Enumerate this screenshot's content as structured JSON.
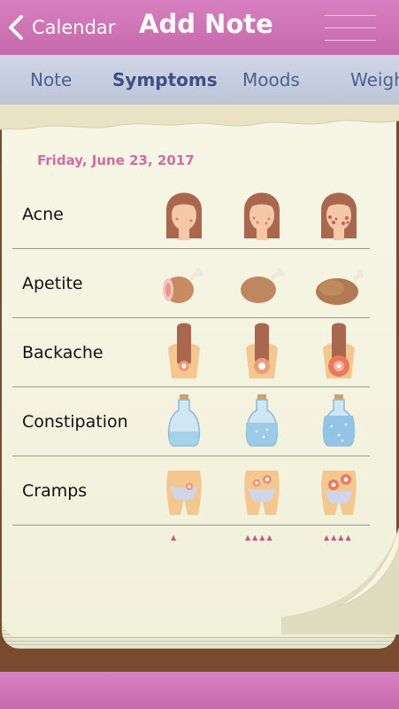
{
  "header": {
    "back_label": "Calendar",
    "title": "Add Note"
  },
  "tabs": [
    {
      "label": "Note"
    },
    {
      "label": "Symptoms"
    },
    {
      "label": "Moods"
    },
    {
      "label": "Weigh"
    }
  ],
  "content": {
    "date": "Friday, June 23, 2017",
    "rows": [
      {
        "label": "Acne",
        "icon": "face-icon"
      },
      {
        "label": "Apetite",
        "icon": "drumstick-icon"
      },
      {
        "label": "Backache",
        "icon": "back-icon"
      },
      {
        "label": "Constipation",
        "icon": "bottle-icon"
      },
      {
        "label": "Cramps",
        "icon": "hips-icon"
      }
    ],
    "severity_markers": [
      "▲",
      "▲▲▲▲",
      "▲▲▲▲"
    ]
  },
  "colors": {
    "header": "#c56aac",
    "tabs": "#c5cce0",
    "tab_text": "#4d5f93",
    "date": "#d36ba5",
    "paper": "#f5f4e2"
  }
}
